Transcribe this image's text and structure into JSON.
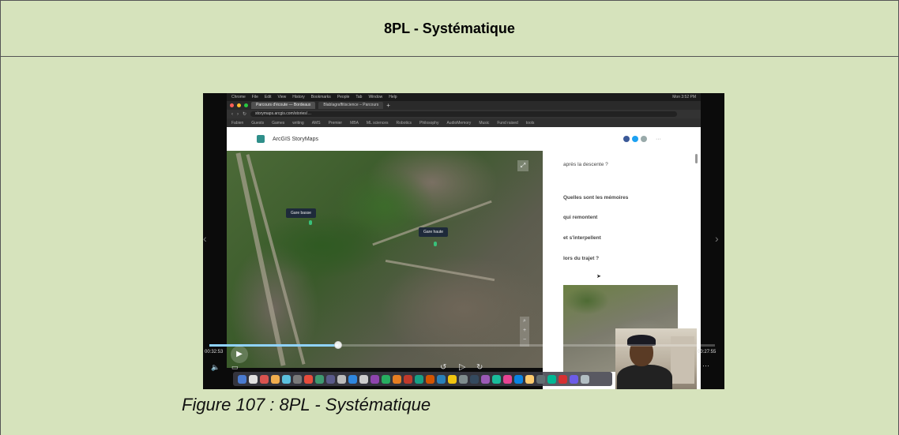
{
  "header": {
    "title": "8PL - Systématique"
  },
  "figure": {
    "caption": "Figure 107 : 8PL - Systématique"
  },
  "video": {
    "menubar": {
      "items": [
        "Chrome",
        "File",
        "Edit",
        "View",
        "History",
        "Bookmarks",
        "People",
        "Tab",
        "Window",
        "Help"
      ],
      "clock": "Mon 3:52 PM"
    },
    "browser": {
      "tabs": [
        "Parcours d'écoute — Bordeaux",
        "Blablagraffitiscience – Parcours"
      ],
      "url": "storymaps.arcgis.com/stories/…",
      "bookmarks": [
        "Fabien",
        "Guests",
        "Games",
        "writing",
        "AMS",
        "Premier",
        "MBA",
        "ML sciences",
        "Robotics",
        "Philosophy",
        "AudioMemory",
        "Music",
        "Fund raised",
        "tools"
      ]
    },
    "storymaps": {
      "brand": "ArcGIS StoryMaps",
      "map_labels": [
        "Gare basse",
        "Gare haute"
      ],
      "panel_lines": [
        "après la descente ?",
        "Quelles sont les mémoires",
        "qui remontent",
        "et s'interpellent",
        "lors du trajet ?"
      ]
    },
    "player": {
      "progress_fraction": 0.255,
      "time_elapsed": "00:32:53",
      "time_remaining": "00:27:55"
    },
    "icons": {
      "play": "play-icon",
      "rewind": "rewind-icon",
      "forward": "forward-icon",
      "volume": "volume-icon",
      "captions": "captions-icon",
      "more": "more-icon",
      "prev": "chevron-left-icon",
      "next": "chevron-right-icon",
      "expand": "expand-icon",
      "zoom": "zoom-icon"
    }
  }
}
